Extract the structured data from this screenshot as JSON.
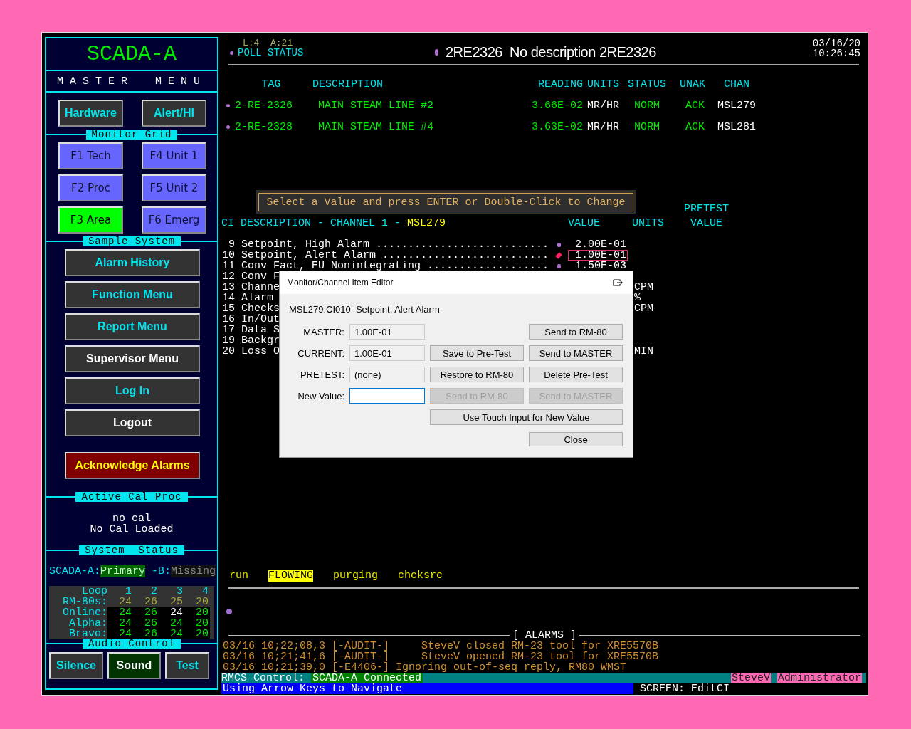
{
  "sidebar": {
    "title": "SCADA-A",
    "subtitle": "MASTER MENU",
    "top_buttons": [
      {
        "label": "Hardware",
        "kind": "accent"
      },
      {
        "label": "Alert/HI",
        "kind": "accent"
      }
    ],
    "monitor_grid": {
      "legend": "Monitor Grid",
      "buttons": [
        {
          "label": "F1 Tech",
          "selected": false
        },
        {
          "label": "F4 Unit 1",
          "selected": false
        },
        {
          "label": "F2 Proc",
          "selected": false
        },
        {
          "label": "F5 Unit 2",
          "selected": false
        },
        {
          "label": "F3 Area",
          "selected": true
        },
        {
          "label": "F6 Emerg",
          "selected": false
        }
      ]
    },
    "sample_system": {
      "legend": "Sample System",
      "buttons": [
        {
          "label": "Alarm History",
          "kind": "accent"
        },
        {
          "label": "Function Menu",
          "kind": "accent"
        },
        {
          "label": "Report Menu",
          "kind": "accent"
        },
        {
          "label": "Supervisor Menu",
          "kind": "plain"
        },
        {
          "label": "Log In",
          "kind": "accent"
        },
        {
          "label": "Logout",
          "kind": "plain"
        }
      ],
      "alarm_button": "Acknowledge Alarms"
    },
    "active_cal": {
      "legend": "Active Cal Proc",
      "lines": [
        "no cal",
        "No Cal Loaded"
      ]
    },
    "system_status": {
      "legend": "System  Status",
      "servers": [
        {
          "label": "SCADA-A:",
          "state": "Primary",
          "kind": "primary"
        },
        {
          "label": " -B:",
          "state": "Missing",
          "kind": "missing"
        }
      ],
      "grid": [
        {
          "label": "Loop",
          "kind": "loop",
          "values": [
            {
              "text": "1",
              "highlighted": false
            },
            {
              "text": "2",
              "highlighted": false
            },
            {
              "text": "3",
              "highlighted": false
            },
            {
              "text": "4",
              "highlighted": false
            }
          ]
        },
        {
          "label": "RM-80s:",
          "kind": "total",
          "values": [
            {
              "text": "24",
              "highlighted": false
            },
            {
              "text": "26",
              "highlighted": false
            },
            {
              "text": "25",
              "highlighted": false
            },
            {
              "text": "20",
              "highlighted": false
            }
          ]
        },
        {
          "label": "Online:",
          "kind": "live",
          "values": [
            {
              "text": "24",
              "highlighted": false
            },
            {
              "text": "26",
              "highlighted": false
            },
            {
              "text": "24",
              "highlighted": true
            },
            {
              "text": "20",
              "highlighted": false
            }
          ]
        },
        {
          "label": "Alpha:",
          "kind": "live",
          "values": [
            {
              "text": "24",
              "highlighted": false
            },
            {
              "text": "26",
              "highlighted": false
            },
            {
              "text": "24",
              "highlighted": false
            },
            {
              "text": "20",
              "highlighted": false
            }
          ]
        },
        {
          "label": "Bravo:",
          "kind": "live",
          "values": [
            {
              "text": "24",
              "highlighted": false
            },
            {
              "text": "26",
              "highlighted": false
            },
            {
              "text": "24",
              "highlighted": false
            },
            {
              "text": "20",
              "highlighted": false
            }
          ]
        }
      ]
    },
    "audio": {
      "legend": "Audio Control",
      "buttons": [
        {
          "label": "Silence",
          "selected": false
        },
        {
          "label": "Sound",
          "selected": true
        },
        {
          "label": "Test",
          "selected": false
        }
      ]
    }
  },
  "header": {
    "counts": "L:4  A:21",
    "poll": "POLL STATUS",
    "title": "2RE2326  No description 2RE2326",
    "date": "03/16/20",
    "time": "10:26:45"
  },
  "monitors": {
    "columns": [
      "TAG",
      "DESCRIPTION",
      "READING",
      "UNITS",
      "STATUS",
      "UNAK",
      "CHAN"
    ],
    "rows": [
      {
        "tag": "2-RE-2326",
        "description": "MAIN STEAM LINE #2",
        "reading": "3.66E-02",
        "units": "MR/HR",
        "status": "NORM",
        "unak": "ACK",
        "chan": "MSL279"
      },
      {
        "tag": "2-RE-2328",
        "description": "MAIN STEAM LINE #4",
        "reading": "3.63E-02",
        "units": "MR/HR",
        "status": "NORM",
        "unak": "ACK",
        "chan": "MSL281"
      }
    ]
  },
  "prompt": "Select a Value and press ENTER or Double-Click to Change",
  "ci_list": {
    "title": "CI DESCRIPTION - CHANNEL 1 - ",
    "channel": "MSL279",
    "value_header": "VALUE",
    "units_header": "UNITS",
    "pretest_header": "PRETEST",
    "pretest_value_header": "VALUE",
    "rows": [
      {
        "number": "9",
        "description": "Setpoint, High Alarm ...........................",
        "value": "2.00E-01",
        "selected": false
      },
      {
        "number": "10",
        "description": "Setpoint, Alert Alarm ..........................",
        "value": "1.00E-01",
        "selected": true
      },
      {
        "number": "11",
        "description": "Conv Fact, EU Nonintegrating ...................",
        "value": "1.50E-03",
        "selected": false
      },
      {
        "number": "12",
        "description": "Conv F"
      },
      {
        "number": "13",
        "description": "Channe",
        "units": "CPM"
      },
      {
        "number": "14",
        "description": "Alarm",
        "units": "%"
      },
      {
        "number": "15",
        "description": "Checks",
        "units": "CPM"
      },
      {
        "number": "16",
        "description": "In/Out"
      },
      {
        "number": "17",
        "description": "Data S"
      },
      {
        "number": "19",
        "description": "Backgr"
      },
      {
        "number": "20",
        "description": "Loss O",
        "units": "MIN"
      }
    ]
  },
  "process_states": [
    {
      "label": "run",
      "active": false
    },
    {
      "label": "FLOWING",
      "active": true
    },
    {
      "label": "purging",
      "active": false
    },
    {
      "label": "chcksrc",
      "active": false
    }
  ],
  "alarms": {
    "title": "[ ALARMS ]",
    "lines": [
      "03/16 10;22;08,3 [-AUDIT-]     SteveV closed RM-23 tool for XRE5570B",
      "03/16 10;21;41,6 [-AUDIT-]     SteveV opened RM-23 tool for XRE5570B",
      "03/16 10;21;39,0 [-E4406-] Ignoring out-of-seq reply, RM80 WMST"
    ]
  },
  "status_bar": {
    "label": "RMCS Control:",
    "connection": "SCADA-A Connected",
    "user": "SteveV",
    "role": "Administrator",
    "hint": "Using Arrow Keys to Navigate",
    "screen": "SCREEN: EditCI"
  },
  "dialog": {
    "title": "Monitor/Channel Item Editor",
    "heading": "MSL279:CI010  Setpoint, Alert Alarm",
    "rows": [
      {
        "label": "MASTER:",
        "value": "1.00E-01",
        "editable": false,
        "focused": false,
        "actions": [
          {
            "label": "Send to RM-80",
            "disabled": false,
            "kind": "normal"
          }
        ]
      },
      {
        "label": "CURRENT:",
        "value": "1.00E-01",
        "editable": false,
        "focused": false,
        "actions": [
          {
            "label": "Save to Pre-Test",
            "disabled": false,
            "kind": "normal"
          },
          {
            "label": "Send to MASTER",
            "disabled": false,
            "kind": "normal"
          }
        ]
      },
      {
        "label": "PRETEST:",
        "value": "(none)",
        "editable": false,
        "focused": false,
        "actions": [
          {
            "label": "Restore to RM-80",
            "disabled": false,
            "kind": "normal"
          },
          {
            "label": "Delete Pre-Test",
            "disabled": false,
            "kind": "normal"
          }
        ]
      },
      {
        "label": "New Value:",
        "editable": true,
        "focused": true,
        "actions": [
          {
            "label": "Send to RM-80",
            "disabled": true,
            "kind": "normal"
          },
          {
            "label": "Send to MASTER",
            "disabled": true,
            "kind": "normal"
          }
        ]
      },
      {
        "actions": [
          {
            "label": "Use Touch Input for New Value",
            "disabled": false,
            "kind": "wide"
          }
        ]
      },
      {
        "actions": [
          {
            "label": "Close",
            "disabled": false,
            "kind": "normal"
          }
        ]
      }
    ]
  }
}
